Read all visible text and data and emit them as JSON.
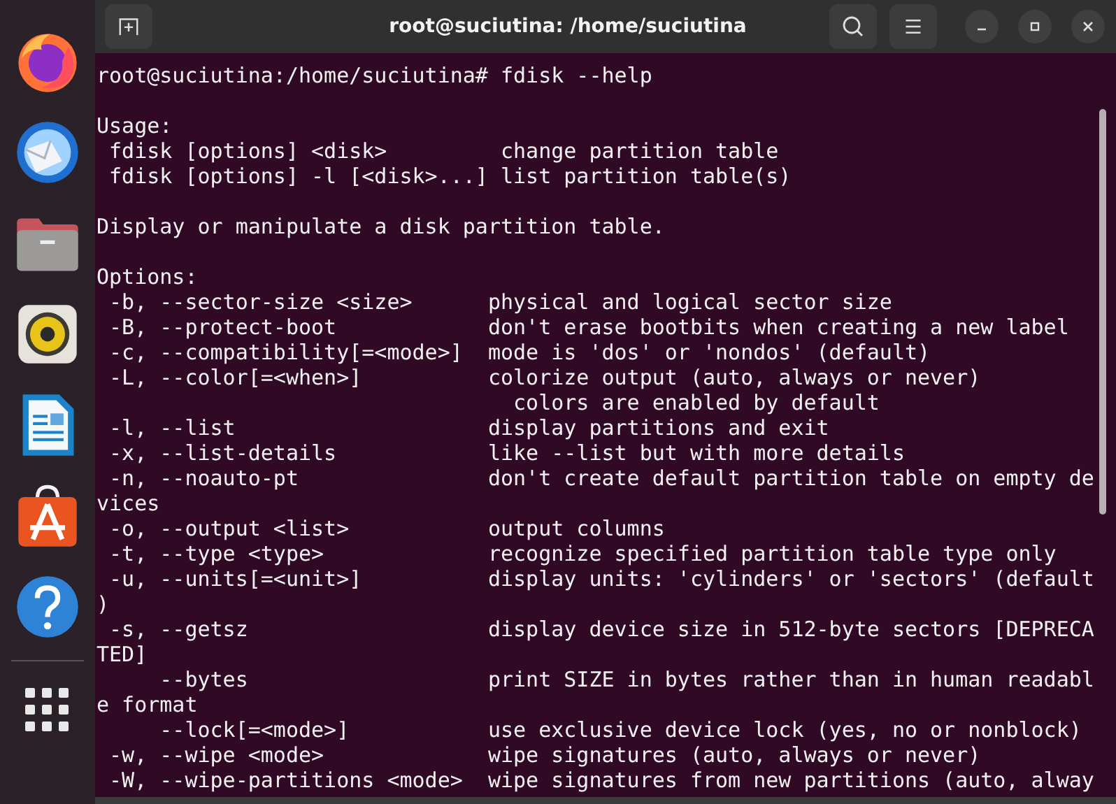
{
  "dock": {
    "apps": [
      {
        "kind": "firefox"
      },
      {
        "kind": "thunderbird"
      },
      {
        "kind": "files"
      },
      {
        "kind": "rhythmbox"
      },
      {
        "kind": "writer"
      },
      {
        "kind": "software"
      },
      {
        "kind": "help"
      }
    ]
  },
  "window": {
    "title": "root@suciutina: /home/suciutina"
  },
  "terminal": {
    "blocks": [
      [
        "root@suciutina:/home/suciutina# fdisk --help"
      ],
      [
        "Usage:",
        " fdisk [options] <disk>         change partition table",
        " fdisk [options] -l [<disk>...] list partition table(s)"
      ],
      [
        "Display or manipulate a disk partition table."
      ],
      [
        "Options:",
        " -b, --sector-size <size>      physical and logical sector size",
        " -B, --protect-boot            don't erase bootbits when creating a new label",
        " -c, --compatibility[=<mode>]  mode is 'dos' or 'nondos' (default)",
        " -L, --color[=<when>]          colorize output (auto, always or never)",
        "                                 colors are enabled by default",
        " -l, --list                    display partitions and exit",
        " -x, --list-details            like --list but with more details",
        " -n, --noauto-pt               don't create default partition table on empty de",
        "vices",
        " -o, --output <list>           output columns",
        " -t, --type <type>             recognize specified partition table type only",
        " -u, --units[=<unit>]          display units: 'cylinders' or 'sectors' (default",
        ")",
        " -s, --getsz                   display device size in 512-byte sectors [DEPRECA",
        "TED]",
        "     --bytes                   print SIZE in bytes rather than in human readabl",
        "e format",
        "     --lock[=<mode>]           use exclusive device lock (yes, no or nonblock)",
        " -w, --wipe <mode>             wipe signatures (auto, always or never)",
        " -W, --wipe-partitions <mode>  wipe signatures from new partitions (auto, alway"
      ]
    ]
  }
}
